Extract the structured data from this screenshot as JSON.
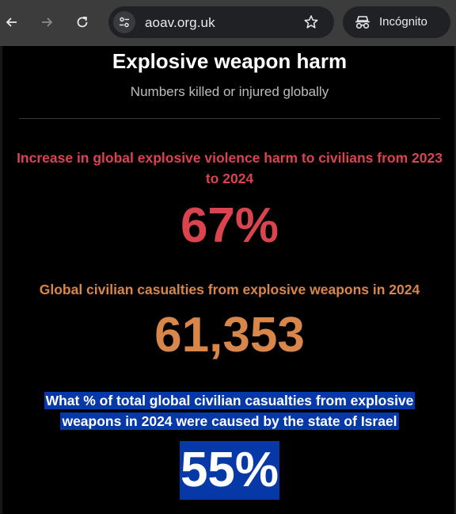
{
  "browser": {
    "url": "aoav.org.uk",
    "incognito_label": "Incógnito"
  },
  "page": {
    "title": "Explosive weapon harm",
    "subtitle": "Numbers killed or injured globally",
    "stats": [
      {
        "label": "Increase in global explosive violence harm to civilians from 2023 to 2024",
        "value": "67%",
        "color": "#d9444f"
      },
      {
        "label": "Global civilian casualties from explosive weapons in 2024",
        "value": "61,353",
        "color": "#d9864a"
      },
      {
        "label": "What % of total global civilian casualties from explosive weapons in 2024 were caused by the state of Israel",
        "value": "55%",
        "color": "#ffffff",
        "highlight": "#0638a8"
      }
    ]
  }
}
